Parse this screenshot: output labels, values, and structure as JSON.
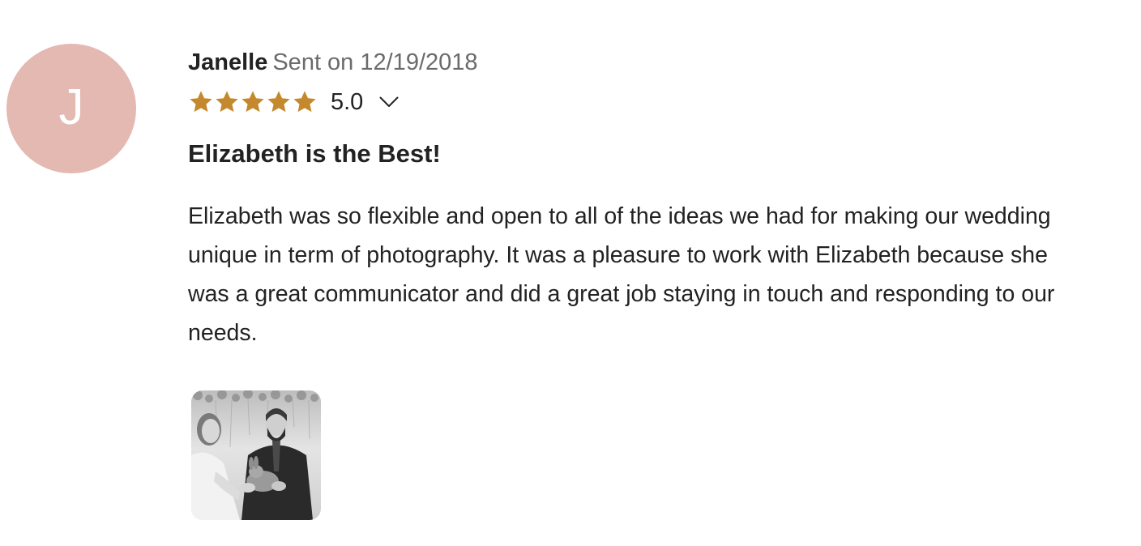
{
  "review": {
    "avatar_letter": "J",
    "avatar_color": "#e3b9b2",
    "reviewer_name": "Janelle",
    "sent_label": "Sent on 12/19/2018",
    "rating": {
      "stars": 5,
      "max_stars": 5,
      "value": "5.0",
      "star_color": "#c4892d",
      "toggle_icon": "chevron-down-icon"
    },
    "title": "Elizabeth is the Best!",
    "body": "Elizabeth was so flexible and open to all of the ideas we had for making our wedding unique in term of photography. It was a pleasure to work with Elizabeth because she was a great communicator and did a great job staying in touch and responding to our needs.",
    "photos": [
      {
        "kind": "black-and-white wedding photo of couple holding a rabbit"
      }
    ]
  }
}
